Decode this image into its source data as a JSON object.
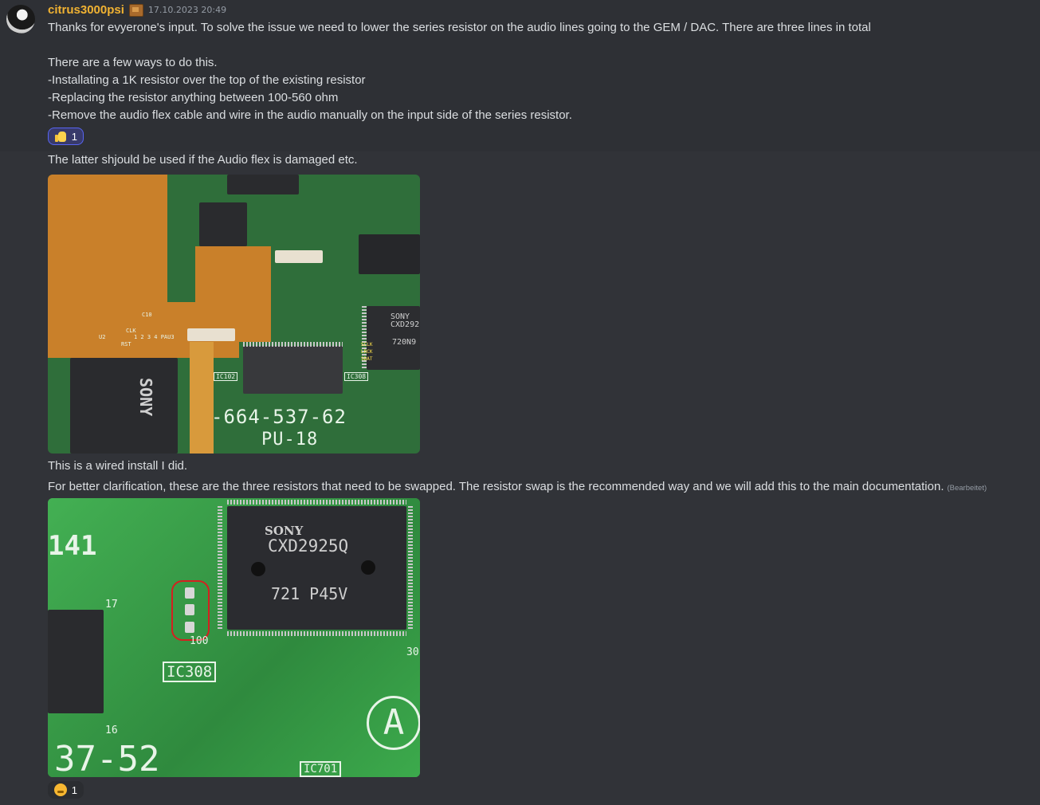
{
  "message": {
    "username": "citrus3000psi",
    "timestamp": "17.10.2023 20:49",
    "lines": [
      "Thanks for evyerone's input.  To solve the issue we need to lower the series resistor on the audio lines going to the GEM / DAC.  There are three lines in total",
      "There are a few ways to do this.",
      "-Installating  a 1K resistor over the top of the existing resistor",
      "-Replacing the resistor anything between 100-560 ohm",
      "-Remove the audio flex cable and wire in the audio manually on the input side of the series resistor."
    ],
    "reaction1": {
      "emoji": "thumbs-up-icon",
      "count": "1"
    }
  },
  "followups": {
    "line_latter": "The latter shjould be used if the Audio flex is damaged etc.",
    "line_wired": "This is a wired install I did.",
    "line_clarify": "For better clarification, these are the three resistors that need to be swapped.   The resistor swap is the recommended way and we will add this to the main documentation.",
    "edited_label": "(Bearbeitet)",
    "reaction2": {
      "emoji": "thinking-face-icon",
      "count": "1"
    }
  },
  "image1": {
    "board_number": "-664-537-62",
    "board_model": "PU-18",
    "chip_brand": "SONY",
    "chip_label_right": "CXD292",
    "chip_code_right": "720N9",
    "ic_labels": [
      "IC102",
      "IC308"
    ],
    "pad_labels": [
      "SCLK",
      "LRCK",
      "SDAT"
    ],
    "flex_labels": [
      "CLK",
      "RST",
      "U2",
      "C10",
      "1 2 3 4 PAU3"
    ]
  },
  "image2": {
    "chip_brand": "SONY",
    "chip_model": "CXD2925Q",
    "chip_code": "721 P45V",
    "ic_label": "IC308",
    "ic_label_bottom": "IC701",
    "silk_left": "141",
    "silk_bottom": "37-52",
    "silk_circle": "A",
    "pin_labels": [
      "17",
      "16",
      "100",
      "30"
    ]
  }
}
